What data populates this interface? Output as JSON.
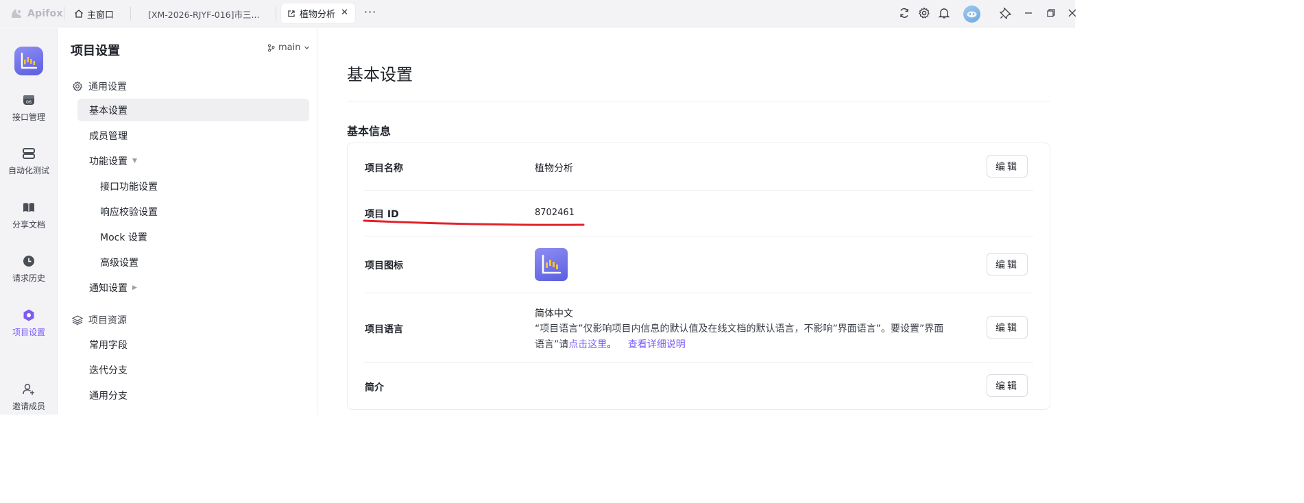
{
  "titlebar": {
    "app_name": "Apifox",
    "home_label": "主窗口",
    "tab1_label": "[XM-2026-RJYF-016]市三...",
    "tab2_label": "植物分析",
    "more_label": "···"
  },
  "rail": {
    "items": [
      {
        "label": "接口管理",
        "icon": "api-icon"
      },
      {
        "label": "自动化测试",
        "icon": "automation-icon"
      },
      {
        "label": "分享文档",
        "icon": "book-icon"
      },
      {
        "label": "请求历史",
        "icon": "clock-icon"
      },
      {
        "label": "项目设置",
        "icon": "hexagon-icon",
        "active": true
      },
      {
        "label": "邀请成员",
        "icon": "user-add-icon"
      }
    ]
  },
  "nav": {
    "title": "项目设置",
    "branch": "main",
    "group_general": "通用设置",
    "items": [
      {
        "label": "基本设置",
        "active": true
      },
      {
        "label": "成员管理"
      },
      {
        "label": "功能设置"
      },
      {
        "label": "接口功能设置"
      },
      {
        "label": "响应校验设置"
      },
      {
        "label": "Mock 设置"
      },
      {
        "label": "高级设置"
      },
      {
        "label": "通知设置"
      }
    ],
    "group_resources": "项目资源",
    "resource_items": [
      {
        "label": "常用字段"
      },
      {
        "label": "迭代分支"
      },
      {
        "label": "通用分支"
      }
    ]
  },
  "main": {
    "title": "基本设置",
    "section": "基本信息",
    "rows": {
      "name_label": "项目名称",
      "name_value": "植物分析",
      "id_label": "项目 ID",
      "id_value": "8702461",
      "icon_label": "项目图标",
      "lang_label": "项目语言",
      "lang_value": "简体中文",
      "lang_desc_prefix": "“项目语言”仅影响项目内信息的默认值及在线文档的默认语言，不影响”界面语言”。要设置”界面语言”请",
      "lang_link_here": "点击这里",
      "lang_desc_mid": "。 ",
      "lang_link_detail": "查看详细说明",
      "intro_label": "简介"
    },
    "edit_label": "编辑"
  },
  "colors": {
    "accent": "#7b5cf5",
    "annotation_red": "#e3212b",
    "logo_gradient_start": "#8d8ef2",
    "logo_gradient_end": "#5b5ee0"
  }
}
